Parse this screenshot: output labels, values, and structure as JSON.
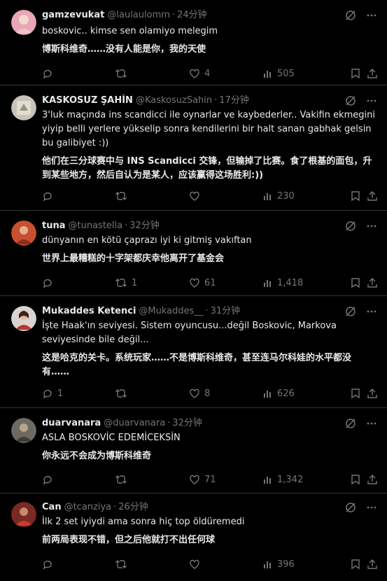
{
  "tweets": [
    {
      "name": "gamzevukat",
      "handle": "@laulaulomm",
      "time": "24分钟",
      "text": "boskovic.. kimse sen olamiyo melegim",
      "translation": "博斯科维奇……没有人能是你，我的天使",
      "replies": "",
      "retweets": "",
      "likes": "4",
      "views": "505",
      "avatar_color": "#e7a7b6"
    },
    {
      "name": "KASKOSUZ ŞAHİN",
      "handle": "@KaskosuzSahin",
      "time": "17分钟",
      "text": "3'luk maçında ins scandicci ile oynarlar ve kaybederler.. Vakifin ekmegini yiyip belli yerlere yükselip sonra kendilerini bir halt sanan gabhak gelsin bu galibiyet :))",
      "translation": "他们在三分球赛中与 INS Scandicci 交锋，但输掉了比赛。食了根基的面包，升到某些地方，然后自认为是某人，应该赢得这场胜利:))",
      "replies": "",
      "retweets": "",
      "likes": "",
      "views": "230",
      "avatar_color": "#c9c2b8"
    },
    {
      "name": "tuna",
      "handle": "@tunastella",
      "time": "32分钟",
      "text": "dünyanın en kötü çaprazı iyi ki gitmiş vakıftan",
      "translation": "世界上最糟糕的十字架都庆幸他离开了基金会",
      "replies": "",
      "retweets": "1",
      "likes": "61",
      "views": "1,418",
      "avatar_color": "#c8502f"
    },
    {
      "name": "Mukaddes Ketenci",
      "handle": "@Mukaddes__",
      "time": "31分钟",
      "text": "İşte Haak'ın seviyesi. Sistem oyuncusu...değil Boskovic, Markova seviyesinde bile değil...",
      "translation": "这是哈克的关卡。系统玩家……不是博斯科维奇，甚至连马尔科娃的水平都没有……",
      "replies": "1",
      "retweets": "",
      "likes": "8",
      "views": "626",
      "avatar_color": "#b8362f"
    },
    {
      "name": "duarvanara",
      "handle": "@duarvanara",
      "time": "32分钟",
      "text": "ASLA BOSKOVİC EDEMİCEKSİN",
      "translation": "你永远不会成为博斯科维奇",
      "replies": "",
      "retweets": "",
      "likes": "71",
      "views": "1,342",
      "avatar_color": "#6e6a62"
    },
    {
      "name": "Can",
      "handle": "@tcanziya",
      "time": "26分钟",
      "text": "İlk 2 set iyiydi ama sonra hiç top öldüremedi",
      "translation": "前两局表现不错，但之后他就打不出任何球",
      "replies": "",
      "retweets": "",
      "likes": "",
      "views": "396",
      "avatar_color": "#7a2a22"
    }
  ]
}
